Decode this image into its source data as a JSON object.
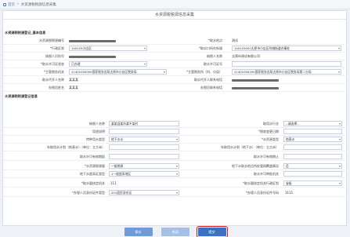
{
  "breadcrumb": {
    "home": "首页",
    "sep": ">",
    "current": "水资源税税源信息采集"
  },
  "panel_title": "水资源税税源信息采集",
  "section1": "水资源税税源登记_基本信息",
  "section2": "水资源税税源登记信息",
  "basic": {
    "r1": {
      "l1": "水资源税税源编号",
      "l2": "*取水地点",
      "v2": "测试"
    },
    "r2": {
      "l1": "*行政区划",
      "v1": "140105小店区",
      "l2": "*取水口所在街道",
      "v2": "140105000太原市小店区坞城街道办事处"
    },
    "r3": {
      "l1": "纳税人识别号",
      "l2": "纳税人名称",
      "v2": "太原市测试有限公司"
    },
    "r4": {
      "l1": "*取水许可证状态",
      "v1": "已办理",
      "l2": "取水许可证号"
    },
    "r5": {
      "l1": "*主管税务机关",
      "v1": "21401050000国家税务总局太原市小店区税务局",
      "l2": "*主管税务所（科、分局）",
      "v2": "21401050200国家税务总局太原市小店区税务局第二分局"
    },
    "r6": {
      "l1": "取水代开人名称",
      "v1": "某某某",
      "l2": "取水代开人联系电话"
    },
    "r7": {
      "l1": "办税员姓名",
      "v1": "某某某",
      "l2": "办税员联系电话"
    }
  },
  "detail": {
    "r1": {
      "l1": "纳税人名称",
      "v1": "某某县某市某乡某村",
      "l2": "取用水行业",
      "v2": "--请选择--"
    },
    "r2": {
      "l1": "用途说明",
      "l2": "*税收变更日期"
    },
    "r3": {
      "l1": "特种用水类型",
      "v1": "地下水水",
      "l2": "*水资源类型",
      "v2": "地表水"
    },
    "r4": {
      "l1": "年取用水计划（地表水）（单位：立方米）",
      "l2": "年取用水计划（地下水）（单位：立方米）"
    },
    "r5": {
      "l1": "取水许可有效期起",
      "l2": "取水许可有效期止"
    },
    "r6": {
      "l1": "*水资源税源量",
      "v1": "一般税源",
      "l2": "地下水取水地点所处管网覆盖情况",
      "v2": "否"
    },
    "r7": {
      "l1": "地下水超采区类型",
      "v1": "1一般超采地区",
      "l2": "取水许可审批机关"
    },
    "r8": {
      "l1": "*取水量核定机关",
      "v1": "111",
      "l2": "*取水量核定机关行政区划",
      "v2": "省级"
    },
    "r9": {
      "l1": "*办理人员身份证件类型",
      "v1": "201居民身份证",
      "l2": "*办理人员身份证件号码",
      "v2": "1111"
    }
  },
  "buttons": {
    "save": "保存",
    "close": "关闭",
    "submit": "提交"
  }
}
